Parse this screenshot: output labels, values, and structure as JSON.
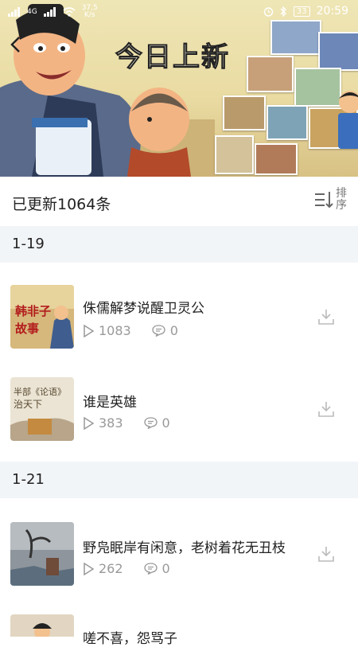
{
  "status_bar": {
    "net_speed_value": "37.5",
    "net_speed_unit": "K/s",
    "network": "4G",
    "battery": "33",
    "time": "20:59"
  },
  "hero": {
    "title": "今日上新"
  },
  "list_header": {
    "count_text": "已更新1064条",
    "sort_label": "排序"
  },
  "groups": [
    {
      "label": "1-19",
      "items": [
        {
          "title": "侏儒解梦说醒卫灵公",
          "plays": "1083",
          "comments": "0",
          "thumb_text": "韩非子故事",
          "thumb_text_line1": "韩非子",
          "thumb_text_line2": "故事"
        },
        {
          "title": "谁是英雄",
          "plays": "383",
          "comments": "0",
          "thumb_text_line1": "半部《论语》",
          "thumb_text_line2": "治天下"
        }
      ]
    },
    {
      "label": "1-21",
      "items": [
        {
          "title": "野凫眠岸有闲意，老树着花无丑枝",
          "plays": "262",
          "comments": "0"
        },
        {
          "title": "嗟不喜，怨骂子",
          "plays": "",
          "comments": ""
        }
      ]
    }
  ],
  "colors": {
    "accent_text": "#222222",
    "muted": "#999999",
    "section_bg": "#f2f5f8"
  }
}
